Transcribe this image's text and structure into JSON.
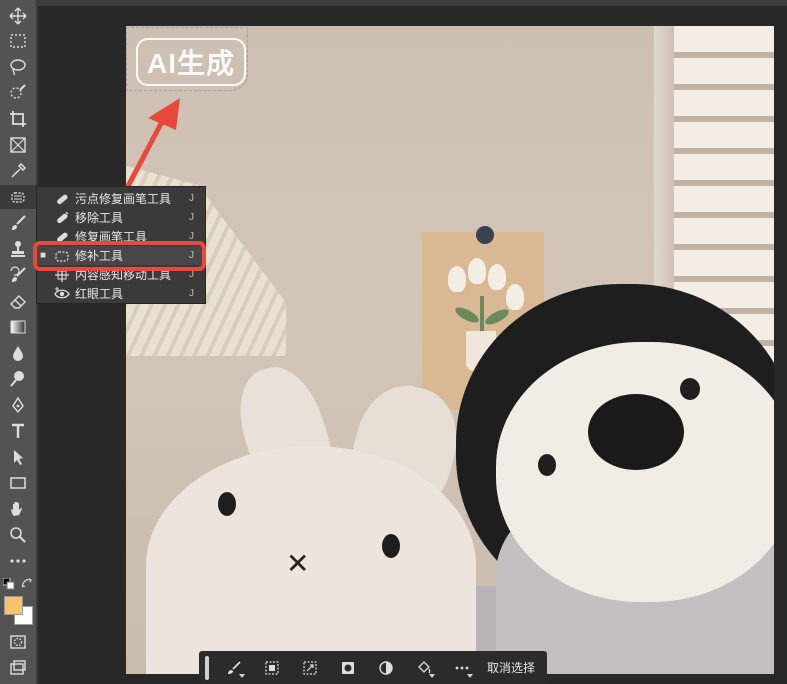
{
  "ai_tag": {
    "label": "AI生成"
  },
  "healing_flyout": {
    "items": [
      {
        "label": "污点修复画笔工具",
        "shortcut": "J",
        "icon": "spot-healing-brush-icon",
        "selected": false
      },
      {
        "label": "移除工具",
        "shortcut": "J",
        "icon": "remove-tool-icon",
        "selected": false
      },
      {
        "label": "修复画笔工具",
        "shortcut": "J",
        "icon": "healing-brush-icon",
        "selected": false
      },
      {
        "label": "修补工具",
        "shortcut": "J",
        "icon": "patch-tool-icon",
        "selected": true
      },
      {
        "label": "内容感知移动工具",
        "shortcut": "J",
        "icon": "content-aware-move-icon",
        "selected": false
      },
      {
        "label": "红眼工具",
        "shortcut": "J",
        "icon": "red-eye-icon",
        "selected": false
      }
    ]
  },
  "context_bar": {
    "deselect_label": "取消选择"
  },
  "colors": {
    "foreground": "#f6c26b",
    "background": "#ffffff",
    "highlight": "#e8493a"
  }
}
